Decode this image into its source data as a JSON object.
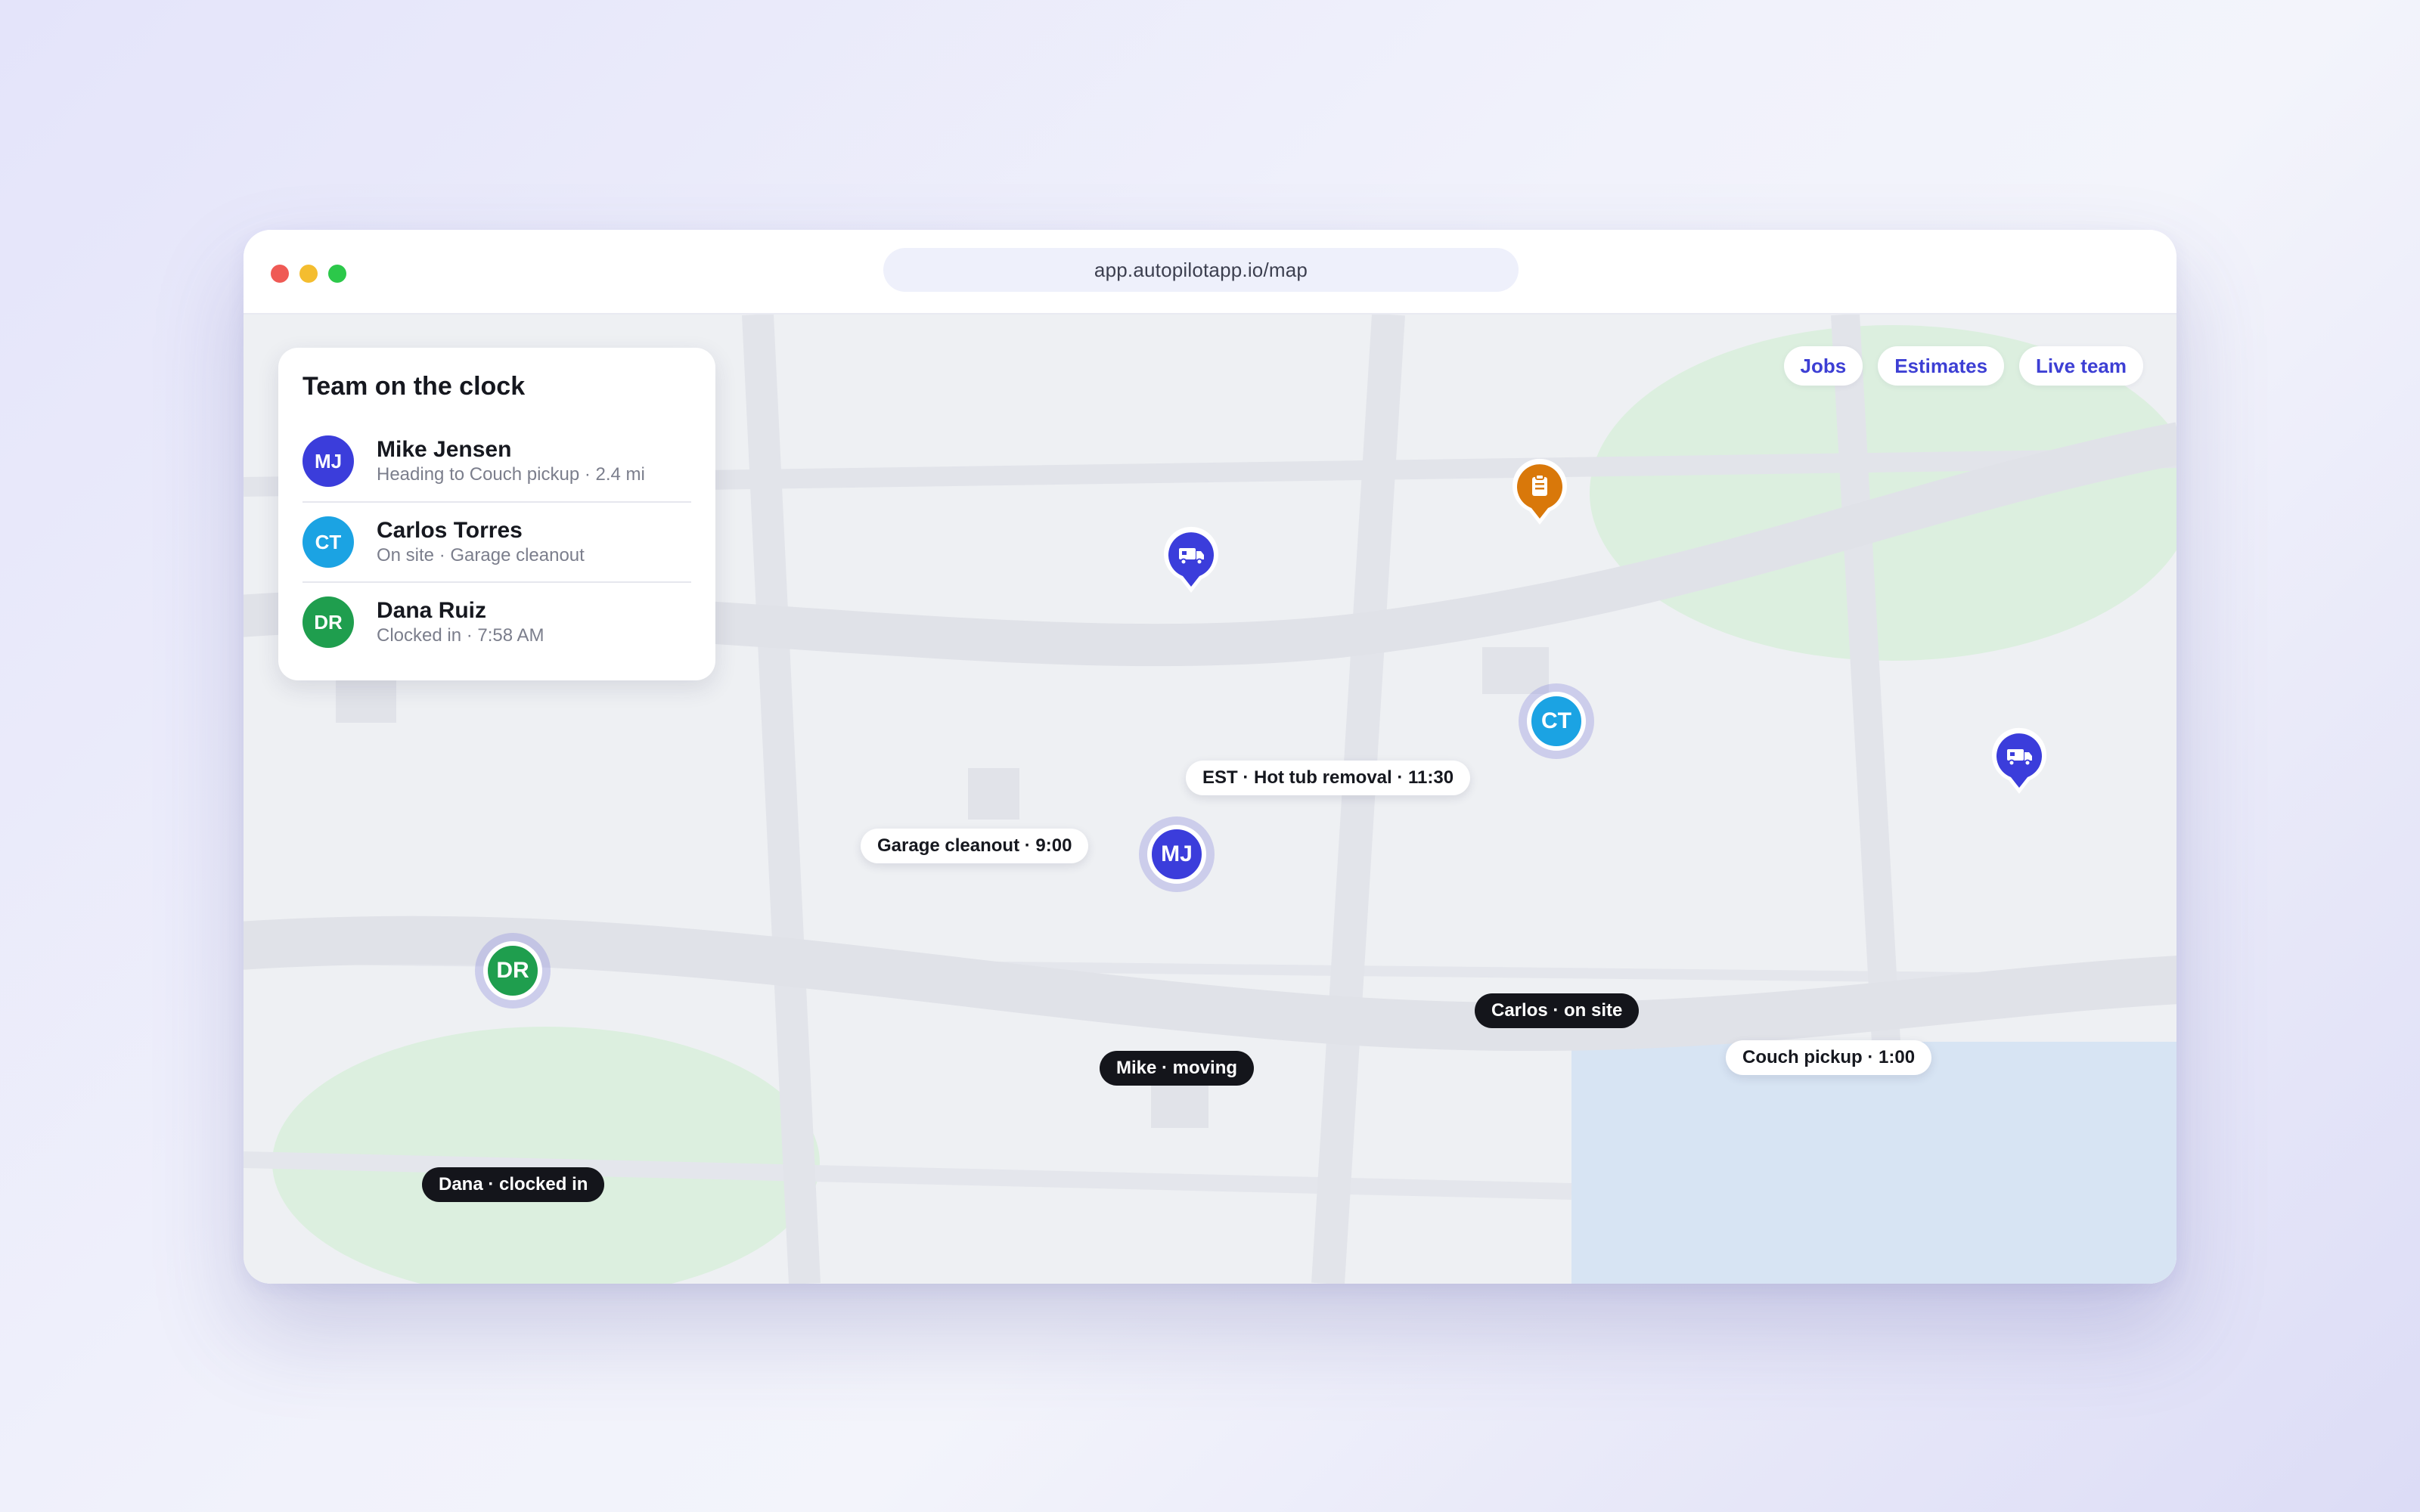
{
  "browser": {
    "url": "app.autopilotapp.io/map"
  },
  "team_panel": {
    "title": "Team on the clock",
    "members": [
      {
        "initials": "MJ",
        "name": "Mike Jensen",
        "status": "Heading to Couch pickup · 2.4 mi",
        "color": "#3b3ddb"
      },
      {
        "initials": "CT",
        "name": "Carlos Torres",
        "status": "On site · Garage cleanout",
        "color": "#1ba3e3"
      },
      {
        "initials": "DR",
        "name": "Dana Ruiz",
        "status": "Clocked in · 7:58 AM",
        "color": "#1f9e4e"
      }
    ]
  },
  "filters": {
    "jobs": "Jobs",
    "estimates": "Estimates",
    "live_team": "Live team"
  },
  "map": {
    "pins": {
      "garage": {
        "label": "Garage cleanout · 9:00",
        "icon": "truck-icon",
        "color": "#3b3ddb"
      },
      "estimate": {
        "label": "EST · Hot tub removal · 11:30",
        "icon": "clipboard-icon",
        "color": "#d9780a"
      },
      "couch": {
        "label": "Couch pickup · 1:00",
        "icon": "truck-icon",
        "color": "#3b3ddb"
      }
    },
    "team_markers": {
      "mike": {
        "initials": "MJ",
        "label": "Mike · moving",
        "color": "#3b3ddb"
      },
      "carlos": {
        "initials": "CT",
        "label": "Carlos · on site",
        "color": "#1ba3e3"
      },
      "dana": {
        "initials": "DR",
        "label": "Dana · clocked in",
        "color": "#1f9e4e"
      }
    }
  }
}
